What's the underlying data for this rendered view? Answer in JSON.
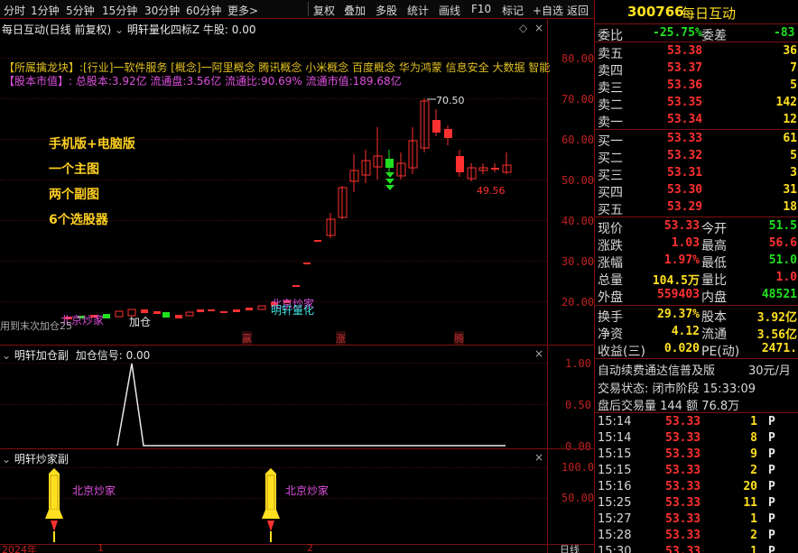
{
  "toolbar": {
    "periods": [
      "分时",
      "1分钟",
      "5分钟",
      "15分钟",
      "30分钟",
      "60分钟",
      "更多>"
    ],
    "actions": [
      "复权",
      "叠加",
      "多股",
      "统计",
      "画线",
      "F10",
      "标记",
      "+自选",
      "返回"
    ]
  },
  "main_chart": {
    "title": "每日互动(日线 前复权)",
    "indicator": "明轩量化四标Z 牛股: 0.00",
    "info_line1": "【所属擒龙块】:[行业]一软件服务 [概念]一阿里概念 腾讯概念 小米概念 百度概念 华为鸿蒙 信息安全 大数据 智能",
    "info_line2": "【股本市值】: 总股本:3.92亿 流通盘:3.56亿 流通比:90.69% 流通市值:189.68亿",
    "promo": [
      "手机版+电脑版",
      "一个主图",
      "两个副图",
      "6个选股器"
    ],
    "y_axis": [
      "80.00",
      "70.00",
      "60.00",
      "50.00",
      "40.00",
      "30.00",
      "20.00"
    ],
    "high_label": "70.50",
    "low_label": "49.56",
    "tags": {
      "beijing1": "北京炒家",
      "beijing2": "北京炒家",
      "addpos": "加仓",
      "mxlh": "明轩量化",
      "left_note": "用到末次加仓25"
    },
    "bottom_marks": [
      "赢",
      "涨",
      "腾"
    ]
  },
  "sub1": {
    "title": "明轩加仓副",
    "signal": "加仓信号: 0.00",
    "y_axis": [
      "1.00",
      "0.50",
      "0.00"
    ]
  },
  "sub2": {
    "title": "明轩炒家副",
    "y_axis": [
      "100.0",
      "50.00"
    ],
    "labels": [
      "北京炒家",
      "北京炒家"
    ],
    "x_axis": [
      "2024年",
      "1",
      "2"
    ],
    "right_corner": "日线"
  },
  "right_panel": {
    "code": "300766",
    "name": "每日互动",
    "weibi_label": "委比",
    "weibi": "-25.75%",
    "weicha_label": "委差",
    "weicha": "-83",
    "asks": [
      {
        "label": "卖五",
        "price": "53.38",
        "vol": "36"
      },
      {
        "label": "卖四",
        "price": "53.37",
        "vol": "7"
      },
      {
        "label": "卖三",
        "price": "53.36",
        "vol": "5"
      },
      {
        "label": "卖二",
        "price": "53.35",
        "vol": "142"
      },
      {
        "label": "卖一",
        "price": "53.34",
        "vol": "12"
      }
    ],
    "bids": [
      {
        "label": "买一",
        "price": "53.33",
        "vol": "61"
      },
      {
        "label": "买二",
        "price": "53.32",
        "vol": "5"
      },
      {
        "label": "买三",
        "price": "53.31",
        "vol": "3"
      },
      {
        "label": "买四",
        "price": "53.30",
        "vol": "31"
      },
      {
        "label": "买五",
        "price": "53.29",
        "vol": "18"
      }
    ],
    "quote": [
      {
        "l1": "现价",
        "v1": "53.33",
        "l2": "今开",
        "v2": "51.5"
      },
      {
        "l1": "涨跌",
        "v1": "1.03",
        "l2": "最高",
        "v2": "56.6"
      },
      {
        "l1": "涨幅",
        "v1": "1.97%",
        "l2": "最低",
        "v2": "51.0"
      },
      {
        "l1": "总量",
        "v1": "104.5万",
        "l2": "量比",
        "v2": "1.0"
      },
      {
        "l1": "外盘",
        "v1": "559403",
        "l2": "内盘",
        "v2": "48521"
      }
    ],
    "fundamentals": [
      {
        "l1": "换手",
        "v1": "29.37%",
        "l2": "股本",
        "v2": "3.92亿"
      },
      {
        "l1": "净资",
        "v1": "4.12",
        "l2": "流通",
        "v2": "3.56亿"
      },
      {
        "l1": "收益(三)",
        "v1": "0.020",
        "l2": "PE(动)",
        "v2": "2471."
      }
    ],
    "promo": "自动续费通达信普及版",
    "promo_price": "30元/月",
    "status": "交易状态: 闭市阶段 15:33:09",
    "after_hours": "盘后交易量 144 额 76.8万",
    "ticks": [
      {
        "t": "15:14",
        "p": "53.33",
        "v": "1",
        "f": "P"
      },
      {
        "t": "15:14",
        "p": "53.33",
        "v": "8",
        "f": "P"
      },
      {
        "t": "15:15",
        "p": "53.33",
        "v": "9",
        "f": "P"
      },
      {
        "t": "15:15",
        "p": "53.33",
        "v": "2",
        "f": "P"
      },
      {
        "t": "15:16",
        "p": "53.33",
        "v": "20",
        "f": "P"
      },
      {
        "t": "15:25",
        "p": "53.33",
        "v": "11",
        "f": "P"
      },
      {
        "t": "15:27",
        "p": "53.33",
        "v": "1",
        "f": "P"
      },
      {
        "t": "15:28",
        "p": "53.33",
        "v": "2",
        "f": "P"
      },
      {
        "t": "15:30",
        "p": "53.33",
        "v": "1",
        "f": "P"
      }
    ]
  },
  "colors": {
    "up": "#ff3030",
    "down": "#20e020",
    "border": "#7a1010",
    "accent": "#ffd020"
  }
}
